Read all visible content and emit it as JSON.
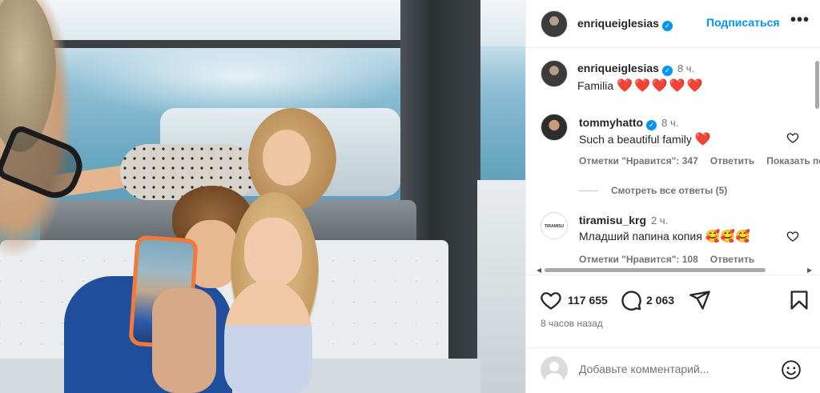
{
  "post": {
    "author": "enriqueiglesias",
    "follow_label": "Подписаться",
    "more_label": "•••",
    "caption_author": "enriqueiglesias",
    "caption_time": "8 ч.",
    "caption_text": "Familia",
    "caption_hearts": "❤️❤️❤️❤️❤️"
  },
  "comments": [
    {
      "author": "tommyhatto",
      "verified": true,
      "time": "8 ч.",
      "text": "Such a beautiful family",
      "emoji": "❤️",
      "likes": "Отметки \"Нравится\": 347",
      "reply": "Ответить",
      "translate": "Показать перевод",
      "view_replies": "Смотреть все ответы (5)"
    },
    {
      "author": "tiramisu_krg",
      "avatar_text": "TIRAMISU",
      "time": "2 ч.",
      "text": "Младший папина копия",
      "emoji": "🥰🥰🥰",
      "likes": "Отметки \"Нравится\": 108",
      "reply": "Ответить"
    }
  ],
  "actions": {
    "likes_count": "117 655",
    "comments_count": "2 063",
    "posted_ago": "8 часов назад"
  },
  "add_comment": {
    "placeholder": "Добавьте комментарий..."
  },
  "icons": {
    "like": "heart-icon",
    "comment": "comment-icon",
    "share": "paper-plane-icon",
    "save": "bookmark-icon",
    "emoji": "smiley-icon",
    "verified": "verified-badge-icon",
    "more": "more-options-icon"
  },
  "colors": {
    "accent": "#0095f6",
    "heart": "#ed1b2e",
    "muted": "#737373",
    "boat_phone_case": "#ef7a3c"
  }
}
